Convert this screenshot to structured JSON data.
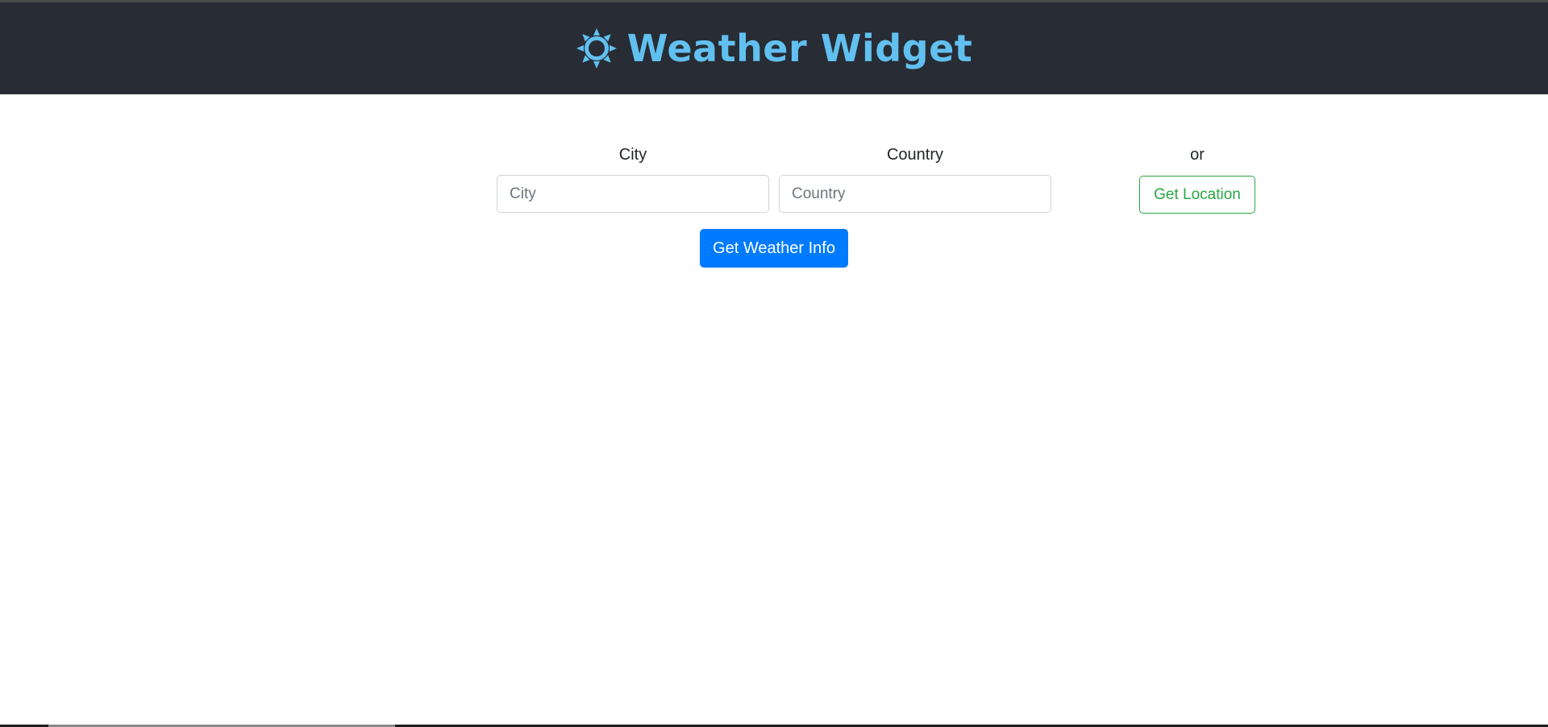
{
  "header": {
    "title": "Weather Widget",
    "icon": "sun-icon",
    "title_color": "#61c0f0",
    "background": "#282c34"
  },
  "form": {
    "city_label": "City",
    "city_placeholder": "City",
    "city_value": "",
    "country_label": "Country",
    "country_placeholder": "Country",
    "country_value": "",
    "or_label": "or",
    "location_button": "Get Location",
    "submit_button": "Get Weather Info"
  },
  "colors": {
    "primary": "#007bff",
    "success": "#28a745"
  }
}
